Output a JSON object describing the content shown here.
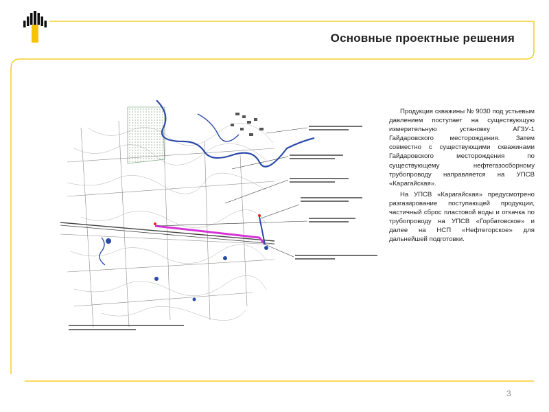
{
  "slide": {
    "title": "Основные проектные решения",
    "paragraphs": [
      "Продукция скважины № 9030 под устьевым давлением поступает на существующую измерительную установку АГЗУ-1 Гайдаровского месторождения. Затем совместно с существующими скважинами Гайдаровского месторождения по существующему нефтегазосборному трубопроводу направляется на УПСВ «Карагайская».",
      "На УПСВ «Карагайская» предусмотрено разгазирование поступающей продукции, частичный сброс пластовой воды и откачка по трубопроводу на УПСВ «Горбатовское» и далее на НСП «Нефтегорское» для дальнейшей подготовки."
    ],
    "page_number": "3"
  },
  "colors": {
    "accent": "#f5c400",
    "logo": "#111111",
    "pipeline": "#d633d6",
    "river": "#2a4aa8"
  },
  "map": {
    "image_name": "pipeline-route-map",
    "callout_icon": "map-callout-label"
  }
}
